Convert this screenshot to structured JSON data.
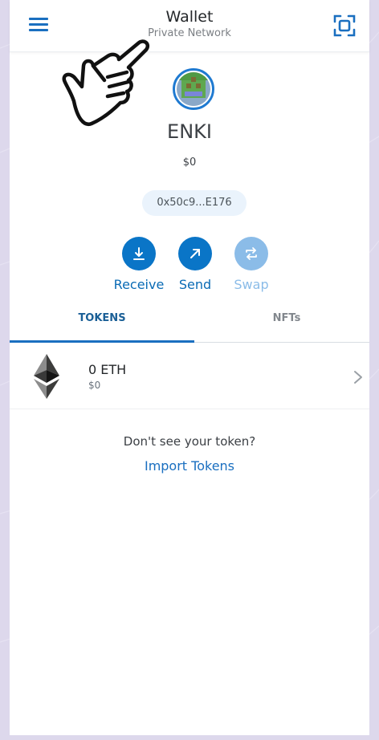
{
  "colors": {
    "accent": "#1a6fc0",
    "button": "#0a75c7",
    "disabled": "#8bbce8",
    "background": "#ddd8ec"
  },
  "header": {
    "title": "Wallet",
    "network": "Private Network",
    "menu_icon": "hamburger-icon",
    "scan_icon": "qr-scan-icon"
  },
  "account": {
    "name": "ENKI",
    "balance": "$0",
    "address": "0x50c9...E176",
    "avatar_icon": "identicon-avatar"
  },
  "actions": [
    {
      "label": "Receive",
      "icon": "download-arrow-icon",
      "enabled": true
    },
    {
      "label": "Send",
      "icon": "arrow-up-right-icon",
      "enabled": true
    },
    {
      "label": "Swap",
      "icon": "swap-icon",
      "enabled": false
    }
  ],
  "tabs": [
    {
      "label": "TOKENS",
      "active": true
    },
    {
      "label": "NFTs",
      "active": false
    }
  ],
  "tokens": [
    {
      "amount": "0 ETH",
      "fiat": "$0",
      "icon": "ethereum-icon"
    }
  ],
  "import": {
    "prompt": "Don't see your token?",
    "link": "Import Tokens"
  }
}
